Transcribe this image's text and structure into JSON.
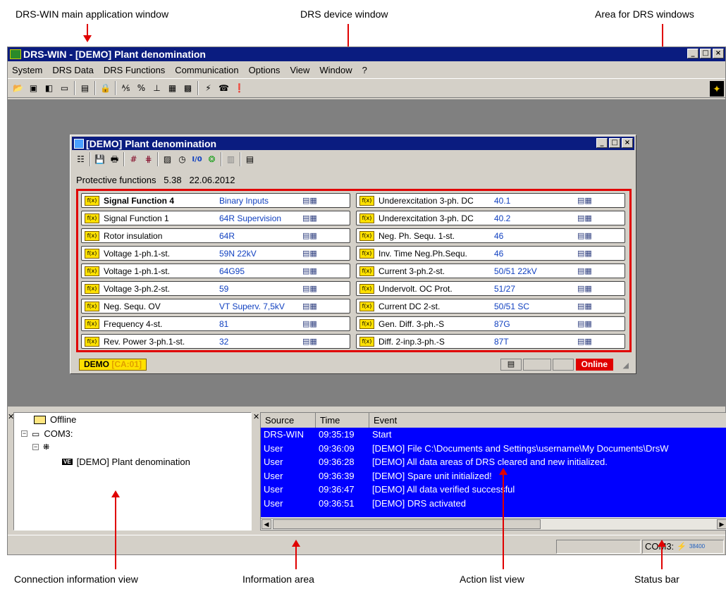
{
  "callouts": {
    "main_window": "DRS-WIN main application window",
    "device_window": "DRS device window",
    "area": "Area for DRS windows",
    "connection_view": "Connection information view",
    "info_area": "Information area",
    "action_list": "Action list view",
    "status_bar": "Status bar"
  },
  "main": {
    "title": "DRS-WIN - [DEMO]  Plant denomination",
    "menu": [
      "System",
      "DRS Data",
      "DRS Functions",
      "Communication",
      "Options",
      "View",
      "Window",
      "?"
    ]
  },
  "device": {
    "title": "[DEMO]  Plant denomination",
    "info_label": "Protective functions",
    "info_version": "5.38",
    "info_date": "22.06.2012",
    "badge_icon": "f(x)",
    "status_demo": "DEMO",
    "status_ca": "[CA:01]",
    "status_online": "Online",
    "functions_left": [
      {
        "name": "Signal Function 4",
        "code": "Binary Inputs",
        "bold": true
      },
      {
        "name": "Signal Function 1",
        "code": "64R Supervision"
      },
      {
        "name": "Rotor insulation",
        "code": "64R"
      },
      {
        "name": "Voltage 1-ph.1-st.",
        "code": "59N 22kV"
      },
      {
        "name": "Voltage 1-ph.1-st.",
        "code": "64G95"
      },
      {
        "name": "Voltage 3-ph.2-st.",
        "code": "59"
      },
      {
        "name": "Neg. Sequ. OV",
        "code": "VT Superv. 7,5kV"
      },
      {
        "name": "Frequency 4-st.",
        "code": "81"
      },
      {
        "name": "Rev. Power 3-ph.1-st.",
        "code": "32"
      }
    ],
    "functions_right": [
      {
        "name": "Underexcitation 3-ph. DC",
        "code": "40.1"
      },
      {
        "name": "Underexcitation 3-ph. DC",
        "code": "40.2"
      },
      {
        "name": "Neg. Ph. Sequ. 1-st.",
        "code": "46"
      },
      {
        "name": "Inv. Time Neg.Ph.Sequ.",
        "code": "46"
      },
      {
        "name": "Current 3-ph.2-st.",
        "code": "50/51 22kV"
      },
      {
        "name": "Undervolt. OC Prot.",
        "code": "51/27"
      },
      {
        "name": "Current DC 2-st.",
        "code": "50/51 SC"
      },
      {
        "name": "Gen. Diff. 3-ph.-S",
        "code": "87G"
      },
      {
        "name": "Diff. 2-inp.3-ph.-S",
        "code": "87T"
      }
    ]
  },
  "connection": {
    "offline": "Offline",
    "com": "COM3:",
    "device_tag": "VE",
    "device": "[DEMO]  Plant denomination"
  },
  "actions": {
    "headers": [
      "Source",
      "Time",
      "Event"
    ],
    "rows": [
      {
        "source": "DRS-WIN",
        "time": "09:35:19",
        "event": "Start"
      },
      {
        "source": "User",
        "time": "09:36:09",
        "event": "[DEMO]  File C:\\Documents and Settings\\username\\My Documents\\DrsW"
      },
      {
        "source": "User",
        "time": "09:36:28",
        "event": "[DEMO]  All data areas of DRS cleared and new initialized."
      },
      {
        "source": "User",
        "time": "09:36:39",
        "event": "[DEMO]  Spare unit initialized!"
      },
      {
        "source": "User",
        "time": "09:36:47",
        "event": "[DEMO]  All data verified successful"
      },
      {
        "source": "User",
        "time": "09:36:51",
        "event": "[DEMO]  DRS activated"
      }
    ]
  },
  "status": {
    "com": "COM3:",
    "baud": "38400"
  }
}
